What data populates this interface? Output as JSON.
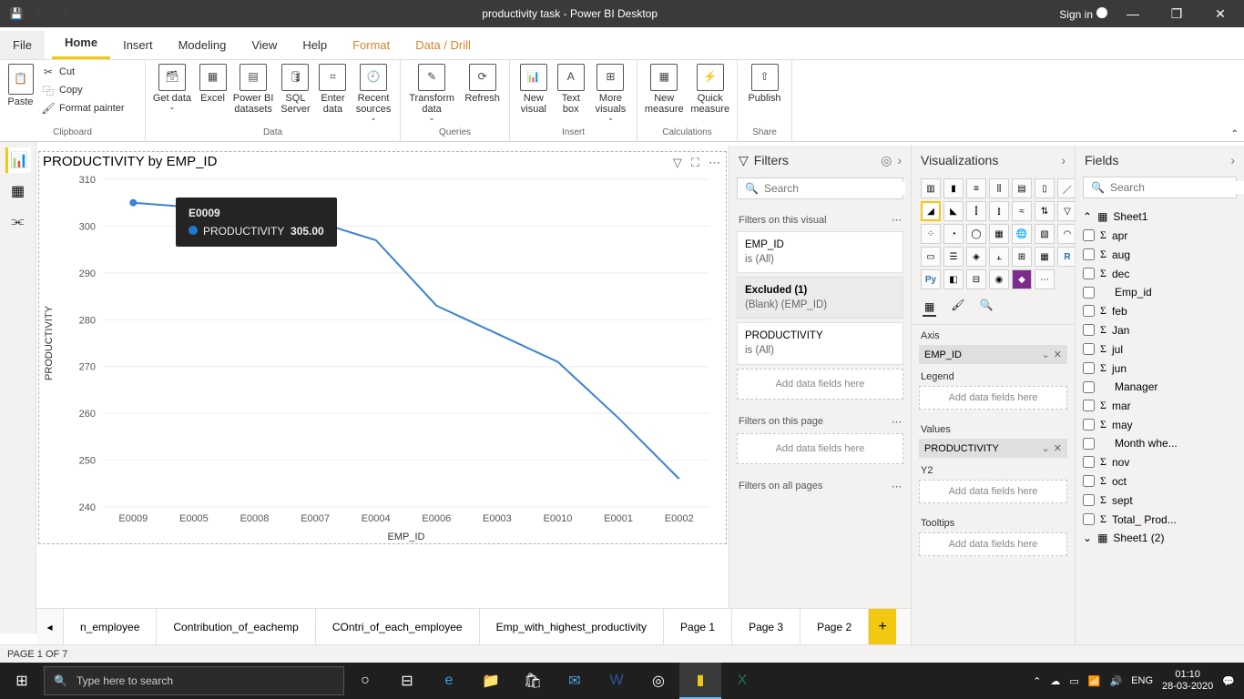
{
  "titlebar": {
    "title": "productivity task - Power BI Desktop",
    "signin": "Sign in"
  },
  "menu": {
    "file": "File",
    "home": "Home",
    "insert": "Insert",
    "modeling": "Modeling",
    "view": "View",
    "help": "Help",
    "format": "Format",
    "datadrill": "Data / Drill"
  },
  "ribbon": {
    "clipboard": {
      "label": "Clipboard",
      "paste": "Paste",
      "cut": "Cut",
      "copy": "Copy",
      "painter": "Format painter"
    },
    "data": {
      "label": "Data",
      "get": "Get data",
      "excel": "Excel",
      "pbids": "Power BI datasets",
      "sql": "SQL Server",
      "enter": "Enter data",
      "recent": "Recent sources"
    },
    "queries": {
      "label": "Queries",
      "transform": "Transform data",
      "refresh": "Refresh"
    },
    "insert": {
      "label": "Insert",
      "newvisual": "New visual",
      "textbox": "Text box",
      "more": "More visuals"
    },
    "calc": {
      "label": "Calculations",
      "newmeasure": "New measure",
      "quick": "Quick measure"
    },
    "share": {
      "label": "Share",
      "publish": "Publish"
    }
  },
  "visual": {
    "title": "PRODUCTIVITY by EMP_ID",
    "ylabel": "PRODUCTIVITY",
    "xlabel": "EMP_ID",
    "tooltip": {
      "id": "E0009",
      "measure": "PRODUCTIVITY",
      "value": "305.00"
    }
  },
  "chart_data": {
    "type": "line",
    "title": "PRODUCTIVITY by EMP_ID",
    "xlabel": "EMP_ID",
    "ylabel": "PRODUCTIVITY",
    "ylim": [
      240,
      310
    ],
    "categories": [
      "E0009",
      "E0005",
      "E0008",
      "E0007",
      "E0004",
      "E0006",
      "E0003",
      "E0010",
      "E0001",
      "E0002"
    ],
    "series": [
      {
        "name": "PRODUCTIVITY",
        "values": [
          305,
          304,
          303,
          301,
          297,
          283,
          277,
          271,
          259,
          246
        ]
      }
    ]
  },
  "filters": {
    "title": "Filters",
    "search": "Search",
    "on_visual": "Filters on this visual",
    "f1_name": "EMP_ID",
    "f1_val": "is (All)",
    "f2_name": "Excluded (1)",
    "f2_val": "(Blank) (EMP_ID)",
    "f3_name": "PRODUCTIVITY",
    "f3_val": "is (All)",
    "add": "Add data fields here",
    "on_page": "Filters on this page",
    "on_all": "Filters on all pages"
  },
  "viz": {
    "title": "Visualizations",
    "axis": "Axis",
    "axis_field": "EMP_ID",
    "legend": "Legend",
    "values": "Values",
    "values_field": "PRODUCTIVITY",
    "y2": "Y2",
    "tooltips": "Tooltips",
    "add": "Add data fields here"
  },
  "fields": {
    "title": "Fields",
    "search": "Search",
    "table1": "Sheet1",
    "table2": "Sheet1 (2)",
    "items": [
      "apr",
      "aug",
      "dec",
      "Emp_id",
      "feb",
      "Jan",
      "jul",
      "jun",
      "Manager",
      "mar",
      "may",
      "Month whe...",
      "nov",
      "oct",
      "sept",
      "Total_ Prod..."
    ],
    "sigma": [
      true,
      true,
      true,
      false,
      true,
      true,
      true,
      true,
      false,
      true,
      true,
      false,
      true,
      true,
      true,
      true
    ]
  },
  "pagetabs": {
    "t1": "n_employee",
    "t2": "Contribution_of_eachemp",
    "t3": "COntri_of_each_employee",
    "t4": "Emp_with_highest_productivity",
    "t5": "Page 1",
    "t6": "Page 3",
    "t7": "Page 2"
  },
  "status": {
    "page": "PAGE 1 OF 7"
  },
  "taskbar": {
    "search": "Type here to search",
    "lang": "ENG",
    "time": "01:10",
    "date": "28-03-2020"
  }
}
